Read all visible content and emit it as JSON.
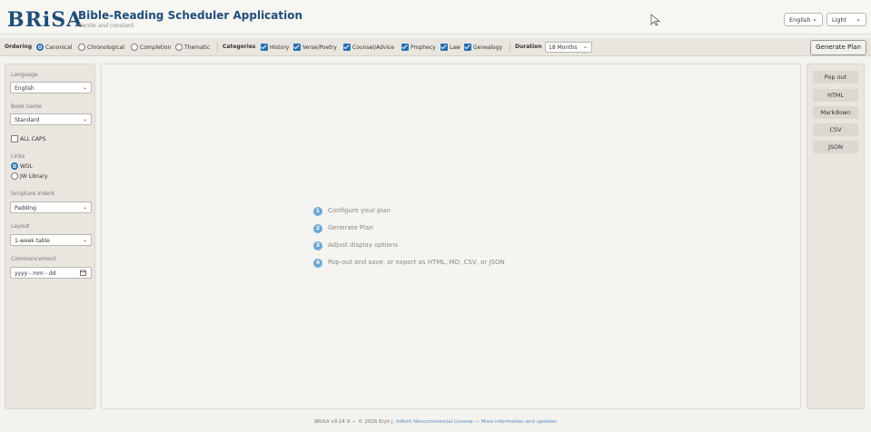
{
  "header": {
    "logo": "BRiSA",
    "title": "Bible-Reading Scheduler Application",
    "subtitle": "Gentle and constant.",
    "language_select": "English",
    "theme_select": "Light"
  },
  "toolbar": {
    "ordering_label": "Ordering",
    "ordering_options": [
      {
        "label": "Canonical",
        "selected": true
      },
      {
        "label": "Chronological",
        "selected": false
      },
      {
        "label": "Completion",
        "selected": false
      },
      {
        "label": "Thematic",
        "selected": false
      }
    ],
    "categories_label": "Categories",
    "categories": [
      {
        "label": "History",
        "checked": true
      },
      {
        "label": "Verse/Poetry",
        "checked": true
      },
      {
        "label": "Counsel/Advice",
        "checked": true
      },
      {
        "label": "Prophecy",
        "checked": true
      },
      {
        "label": "Law",
        "checked": true
      },
      {
        "label": "Genealogy",
        "checked": true
      }
    ],
    "duration_label": "Duration",
    "duration_value": "18 Months",
    "generate_button": "Generate Plan"
  },
  "left_panel": {
    "language_label": "Language",
    "language_value": "English",
    "book_name_label": "Book name",
    "book_name_value": "Standard",
    "all_caps_label": "ALL CAPS",
    "all_caps_checked": false,
    "links_label": "Links",
    "links_options": [
      {
        "label": "WOL",
        "selected": true
      },
      {
        "label": "JW Library",
        "selected": false
      }
    ],
    "indent_label": "Scripture Indent",
    "indent_value": "Padding",
    "layout_label": "Layout",
    "layout_value": "1-week table",
    "commencement_label": "Commencement",
    "commencement_placeholder": "yyyy - mm - dd"
  },
  "main": {
    "steps": [
      {
        "num": "1",
        "text": "Configure your plan"
      },
      {
        "num": "2",
        "text": "Generate Plan"
      },
      {
        "num": "3",
        "text": "Adjust display options"
      },
      {
        "num": "4",
        "text": "Pop-out and save, or export as HTML, MD, CSV, or JSON"
      }
    ]
  },
  "right_panel": {
    "buttons": [
      "Pop out",
      "HTML",
      "Markdown",
      "CSV",
      "JSON"
    ]
  },
  "footer": {
    "text": "BRiSA v9.24.9 — © 2026 Eryk J.",
    "license_link": "Infiniti Noncommercial License",
    "separator": "—",
    "more_link": "More information and updates"
  },
  "colors": {
    "accent": "#2a6fb0",
    "brand": "#1f4e79",
    "step_badge": "#6fa8d6"
  }
}
